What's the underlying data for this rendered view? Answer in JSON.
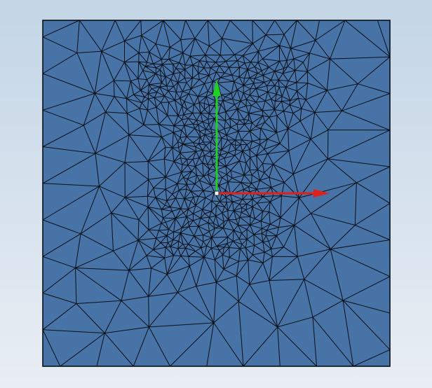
{
  "viewport": {
    "background_top": "#c3d5e6",
    "background_bottom": "#e9eef4"
  },
  "mesh": {
    "face_color": "#4773a6",
    "edge_color": "#0a0f17",
    "border_color": "#0a0f17"
  },
  "triad": {
    "x_axis_color": "#e0201c",
    "y_axis_color": "#22d024",
    "origin_color": "#ffffff"
  }
}
